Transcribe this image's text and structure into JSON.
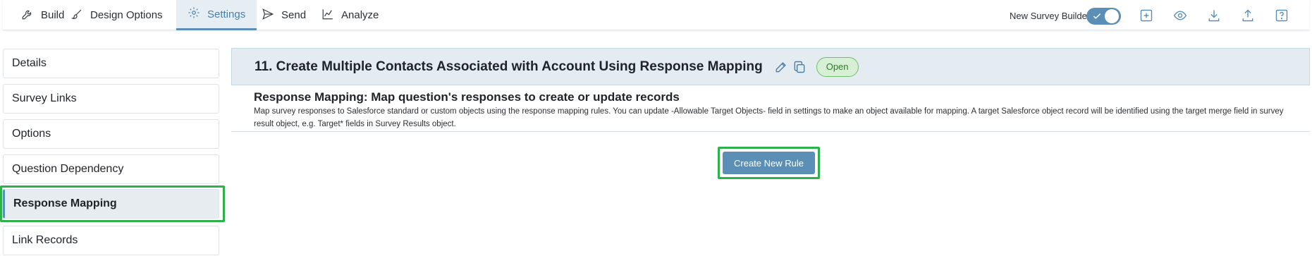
{
  "nav": {
    "tabs": [
      {
        "label": "Build",
        "icon": "wrench-icon"
      },
      {
        "label": "Design Options",
        "icon": "brush-icon"
      },
      {
        "label": "Settings",
        "icon": "gear-icon",
        "active": true
      },
      {
        "label": "Send",
        "icon": "send-icon"
      },
      {
        "label": "Analyze",
        "icon": "line-chart-icon"
      }
    ],
    "builder_label": "New Survey Builder",
    "builder_toggle_on": true,
    "tools": [
      "plus-square-icon",
      "eye-icon",
      "download-icon",
      "upload-icon",
      "help-icon"
    ]
  },
  "sidebar": {
    "items": [
      {
        "label": "Details"
      },
      {
        "label": "Survey Links"
      },
      {
        "label": "Options"
      },
      {
        "label": "Question Dependency"
      },
      {
        "label": "Response Mapping",
        "active": true
      },
      {
        "label": "Link Records"
      }
    ]
  },
  "main": {
    "question_title": "11. Create Multiple Contacts Associated with Account Using Response Mapping",
    "status_badge": "Open",
    "section_title": "Response Mapping: Map question's responses to create or update records",
    "section_description": "Map survey responses to Salesforce standard or custom objects using the response mapping rules. You can update -Allowable Target Objects- field in settings to make an object available for mapping. A target Salesforce object record will be identified using the target merge field in survey result object, e.g. Target* fields in Survey Results object.",
    "create_button": "Create New Rule"
  },
  "colors": {
    "accent": "#5b8fb5",
    "highlight": "#2eb14a",
    "badge_bg": "#d7efd4",
    "badge_text": "#2f7a2b"
  }
}
